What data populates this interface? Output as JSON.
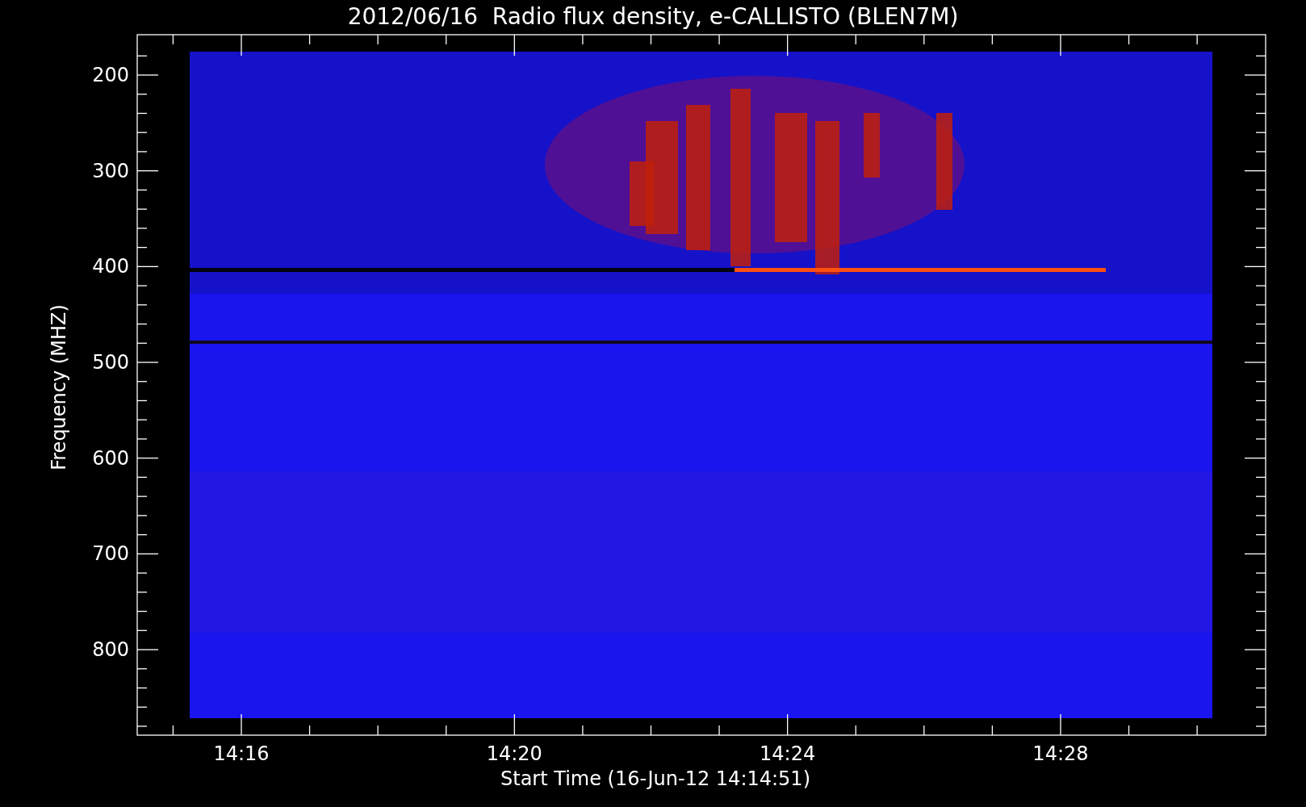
{
  "title": "2012/06/16  Radio flux density, e-CALLISTO (BLEN7M)",
  "y_axis": {
    "label": "Frequency (MHZ)",
    "ticks": [
      "200",
      "300",
      "400",
      "500",
      "600",
      "700",
      "800"
    ]
  },
  "x_axis": {
    "label": "Start Time (16-Jun-12 14:14:51)",
    "ticks": [
      "14:16",
      "14:20",
      "14:24",
      "14:28"
    ]
  }
}
